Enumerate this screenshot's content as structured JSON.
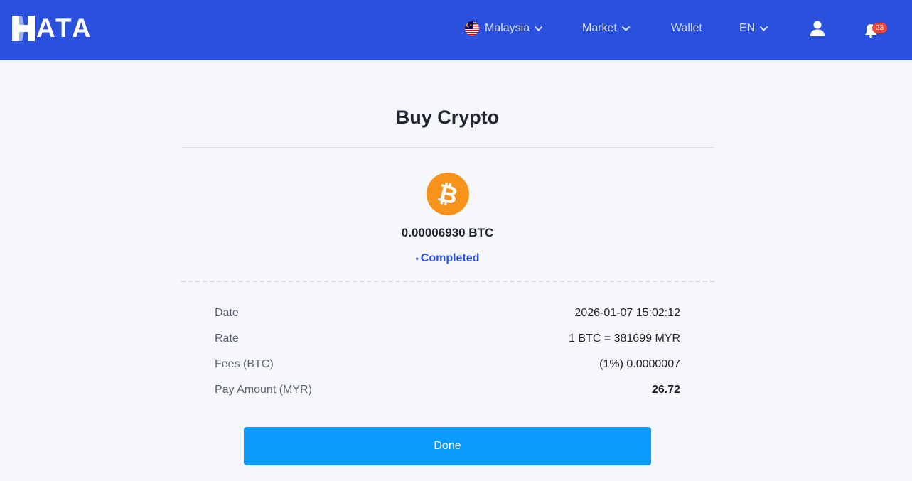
{
  "header": {
    "logo_text": "ATA",
    "nav": {
      "country_label": "Malaysia",
      "market_label": "Market",
      "wallet_label": "Wallet",
      "language_label": "EN"
    },
    "notifications_count": "23",
    "colors": {
      "bar": "#2a51de",
      "badge": "#f04438"
    }
  },
  "main": {
    "title": "Buy Crypto",
    "coin_icon": "bitcoin-icon",
    "amount": "0.00006930 BTC",
    "status": {
      "dot": "•",
      "label": "Completed",
      "color": "#2a51de"
    },
    "details": [
      {
        "label": "Date",
        "value": "2026-01-07 15:02:12"
      },
      {
        "label": "Rate",
        "value": "1 BTC = 381699 MYR"
      },
      {
        "label": "Fees (BTC)",
        "value": "(1%) 0.0000007"
      },
      {
        "label": "Pay Amount (MYR)",
        "value": "26.72"
      }
    ],
    "done_button": "Done",
    "colors": {
      "button": "#0c9bfc",
      "coin": "#f7931a"
    }
  }
}
